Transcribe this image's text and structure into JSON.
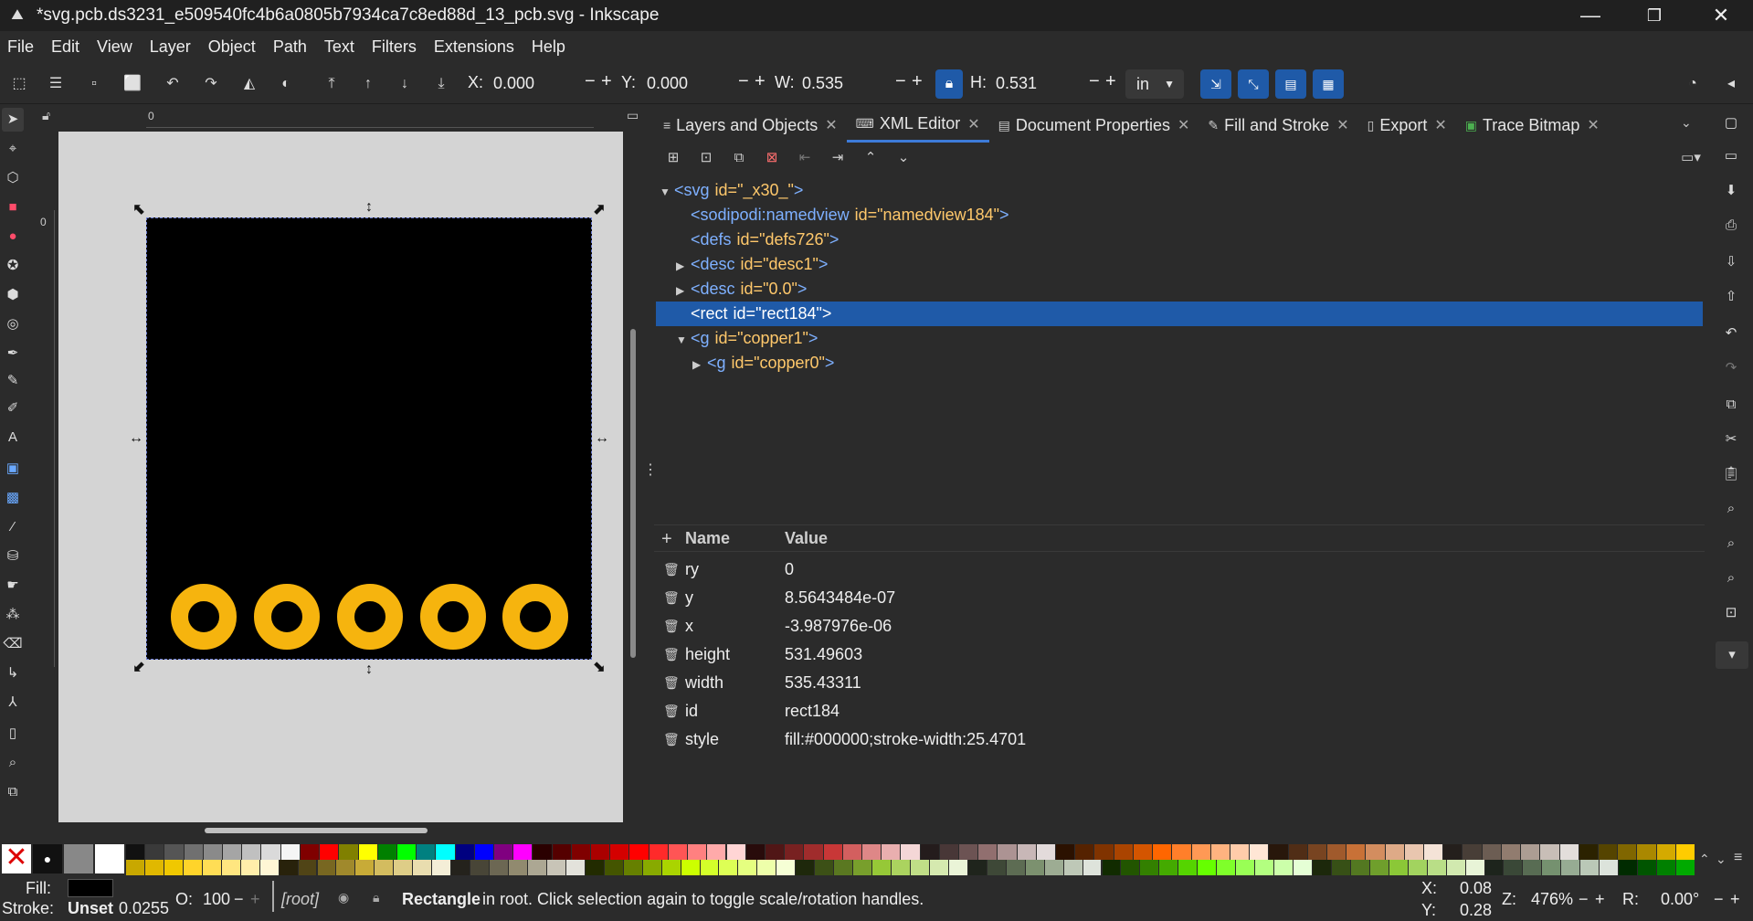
{
  "window": {
    "title": "*svg.pcb.ds3231_e509540fc4b6a0805b7934ca7c8ed88d_13_pcb.svg - Inkscape",
    "minimize": "—",
    "maximize": "❐",
    "close": "✕"
  },
  "menu": [
    "File",
    "Edit",
    "View",
    "Layer",
    "Object",
    "Path",
    "Text",
    "Filters",
    "Extensions",
    "Help"
  ],
  "toolbar": {
    "x_label": "X:",
    "x_value": "0.000",
    "y_label": "Y:",
    "y_value": "0.000",
    "w_label": "W:",
    "w_value": "0.535",
    "h_label": "H:",
    "h_value": "0.531",
    "units": "in",
    "minus": "−",
    "plus": "+"
  },
  "ruler": {
    "h_zero": "0",
    "v_zero": "0"
  },
  "tabs": [
    {
      "label": "Layers and Objects",
      "icon": "layers-icon"
    },
    {
      "label": "XML Editor",
      "icon": "xml-icon",
      "active": true
    },
    {
      "label": "Document Properties",
      "icon": "document-icon"
    },
    {
      "label": "Fill and Stroke",
      "icon": "brush-icon"
    },
    {
      "label": "Export",
      "icon": "export-icon"
    },
    {
      "label": "Trace Bitmap",
      "icon": "trace-icon"
    }
  ],
  "xml_tree": [
    {
      "tag": "<svg",
      "attr": "id=",
      "val": "\"_x30_\"",
      "end": ">",
      "depth": 0,
      "arrow": "▼"
    },
    {
      "tag": "<sodipodi:namedview",
      "attr": "id=",
      "val": "\"namedview184\"",
      "end": ">",
      "depth": 1,
      "arrow": ""
    },
    {
      "tag": "<defs",
      "attr": "id=",
      "val": "\"defs726\"",
      "end": ">",
      "depth": 1,
      "arrow": ""
    },
    {
      "tag": "<desc",
      "attr": "id=",
      "val": "\"desc1\"",
      "end": ">",
      "depth": 1,
      "arrow": "▶"
    },
    {
      "tag": "<desc",
      "attr": "id=",
      "val": "\"0.0\"",
      "end": ">",
      "depth": 1,
      "arrow": "▶"
    },
    {
      "tag": "<rect",
      "attr": "id=",
      "val": "\"rect184\"",
      "end": ">",
      "depth": 1,
      "arrow": "",
      "selected": true
    },
    {
      "tag": "<g",
      "attr": "id=",
      "val": "\"copper1\"",
      "end": ">",
      "depth": 1,
      "arrow": "▼"
    },
    {
      "tag": "<g",
      "attr": "id=",
      "val": "\"copper0\"",
      "end": ">",
      "depth": 2,
      "arrow": "▶"
    }
  ],
  "attr_header": {
    "add": "+",
    "name": "Name",
    "value": "Value"
  },
  "attributes": [
    {
      "name": "ry",
      "value": "0"
    },
    {
      "name": "y",
      "value": "8.5643484e-07"
    },
    {
      "name": "x",
      "value": "-3.987976e-06"
    },
    {
      "name": "height",
      "value": "531.49603"
    },
    {
      "name": "width",
      "value": "535.43311"
    },
    {
      "name": "id",
      "value": "rect184"
    },
    {
      "name": "style",
      "value": "fill:#000000;stroke-width:25.4701"
    }
  ],
  "status": {
    "fill_label": "Fill:",
    "stroke_label": "Stroke:",
    "stroke_value": "Unset",
    "stroke_width": "0.0255",
    "opacity_label": "O:",
    "opacity_value": "100",
    "layer": "[root]",
    "message_bold": "Rectangle",
    "message": " in root. Click selection again to toggle scale/rotation handles.",
    "cx_label": "X:",
    "cx_value": "0.08",
    "cy_label": "Y:",
    "cy_value": "0.28",
    "zoom_label": "Z:",
    "zoom_value": "476%",
    "rot_label": "R:",
    "rot_value": "0.00°"
  },
  "colors": {
    "accent": "#1f5aa8",
    "pad": "#f6b40e",
    "rect_fill": "#000000"
  },
  "palette_top": [
    "#111111",
    "#3a3a3a",
    "#555555",
    "#707070",
    "#8a8a8a",
    "#a5a5a5",
    "#c0c0c0",
    "#dadada",
    "#f5f5f5",
    "#800000",
    "#ff0000",
    "#808000",
    "#ffff00",
    "#008000",
    "#00ff00",
    "#008080",
    "#00ffff",
    "#000080",
    "#0000ff",
    "#800080",
    "#ff00ff",
    "#2a0000",
    "#550000",
    "#800000",
    "#aa0000",
    "#d40000",
    "#ff0000",
    "#ff2a2a",
    "#ff5555",
    "#ff8080",
    "#ffaaaa",
    "#ffd5d5",
    "#280b0b",
    "#501616",
    "#782121",
    "#a02c2c",
    "#c83737",
    "#d35f5f",
    "#de8787",
    "#e9afaf",
    "#f4d7d7",
    "#241c1c",
    "#483737",
    "#6c5353",
    "#916f6f",
    "#ac9393",
    "#c8b7b7",
    "#e3dbdb",
    "#2b1100",
    "#552200",
    "#803300",
    "#aa4400",
    "#d45500",
    "#ff6600",
    "#ff7f2a",
    "#ff9955",
    "#ffb380",
    "#ffccaa",
    "#ffe6d5",
    "#28170b",
    "#502d16",
    "#784421",
    "#a05a2c",
    "#c87137",
    "#d38d5f",
    "#deaa87",
    "#e9c6af",
    "#f4e3d7",
    "#241f1c",
    "#483e37",
    "#6c5d53",
    "#917c6f",
    "#ac9d93",
    "#c8beb7",
    "#e3dedb",
    "#2b2200",
    "#554400",
    "#806600",
    "#aa8800",
    "#d4aa00",
    "#ffcc00"
  ],
  "palette_bottom": [
    "#c8a800",
    "#e0b800",
    "#f0c800",
    "#ffd42a",
    "#ffdd55",
    "#ffe680",
    "#ffeeaa",
    "#fff6d5",
    "#28220b",
    "#504416",
    "#786721",
    "#a0892c",
    "#c8ab37",
    "#d3bc5f",
    "#decd87",
    "#e9ddaf",
    "#f4eed7",
    "#24221c",
    "#484537",
    "#6c6753",
    "#918a6f",
    "#aca793",
    "#c8c4b7",
    "#e3e2db",
    "#222b00",
    "#445500",
    "#668000",
    "#88aa00",
    "#aad400",
    "#ccff00",
    "#d4ff2a",
    "#ddff55",
    "#e5ff80",
    "#eeffaa",
    "#f6ffd5",
    "#1e280b",
    "#3c5016",
    "#5a7821",
    "#789f2c",
    "#96c837",
    "#abd35f",
    "#c0de87",
    "#d5e9af",
    "#eaf4d7",
    "#1f241c",
    "#3e4837",
    "#5d6c53",
    "#7c916f",
    "#9dac93",
    "#bec8b7",
    "#dee3db",
    "#112b00",
    "#225500",
    "#338000",
    "#44aa00",
    "#55d400",
    "#66ff00",
    "#7fff2a",
    "#99ff55",
    "#b3ff80",
    "#ccffaa",
    "#e5ffd5",
    "#1c280b",
    "#375016",
    "#537821",
    "#6f9f2c",
    "#8bc837",
    "#a2d35f",
    "#b9de87",
    "#d1e9af",
    "#e8f4d7",
    "#1d241c",
    "#3a4837",
    "#586c53",
    "#75916f",
    "#97ac93",
    "#bac8b7",
    "#dce3db",
    "#002b00",
    "#005500",
    "#008000",
    "#00aa00"
  ]
}
